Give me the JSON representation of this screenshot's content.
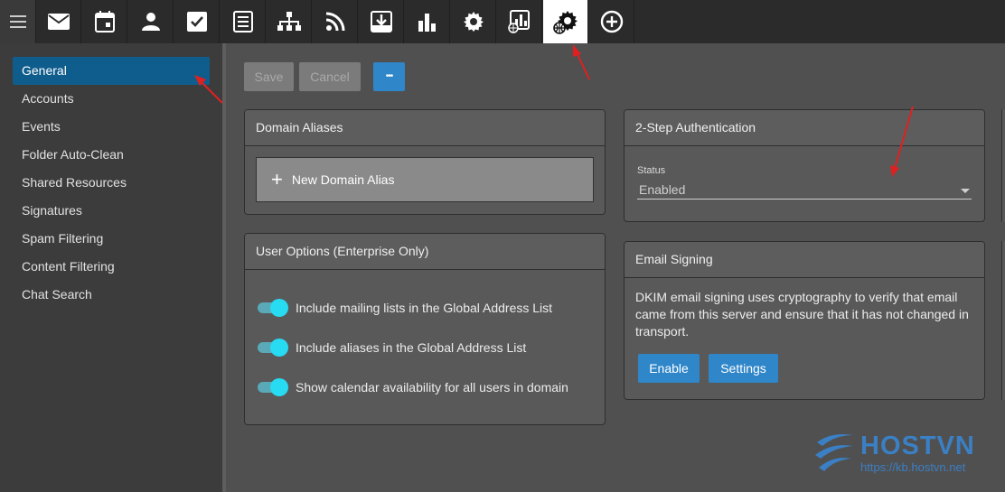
{
  "topbar": {
    "icons": [
      "menu-icon",
      "mail-icon",
      "calendar-icon",
      "contacts-icon",
      "tasks-icon",
      "notes-icon",
      "sitemap-icon",
      "rss-icon",
      "download-icon",
      "reports-icon",
      "settings-icon",
      "domain-reports-icon",
      "domain-settings-icon",
      "add-icon"
    ]
  },
  "sidebar": {
    "items": [
      {
        "label": "General"
      },
      {
        "label": "Accounts"
      },
      {
        "label": "Events"
      },
      {
        "label": "Folder Auto-Clean"
      },
      {
        "label": "Shared Resources"
      },
      {
        "label": "Signatures"
      },
      {
        "label": "Spam Filtering"
      },
      {
        "label": "Content Filtering"
      },
      {
        "label": "Chat Search"
      }
    ]
  },
  "toolbar": {
    "save_label": "Save",
    "cancel_label": "Cancel",
    "more_label": "•••"
  },
  "domain_aliases": {
    "title": "Domain Aliases",
    "new_label": "New Domain Alias"
  },
  "user_options": {
    "title": "User Options (Enterprise Only)",
    "toggles": [
      {
        "label": "Include mailing lists in the Global Address List",
        "on": true
      },
      {
        "label": "Include aliases in the Global Address List",
        "on": true
      },
      {
        "label": "Show calendar availability for all users in domain",
        "on": true
      }
    ]
  },
  "two_step": {
    "title": "2-Step Authentication",
    "status_label": "Status",
    "status_value": "Enabled"
  },
  "email_signing": {
    "title": "Email Signing",
    "description": "DKIM email signing uses cryptography to verify that email came from this server and ensure that it has not changed in transport.",
    "enable_label": "Enable",
    "settings_label": "Settings"
  },
  "watermark": {
    "brand": "HOSTVN",
    "url": "https://kb.hostvn.net"
  },
  "colors": {
    "accent": "#2f86c9",
    "nav_active": "#0f5d8c",
    "toggle": "#27dbf2",
    "annotation": "#e02020"
  }
}
